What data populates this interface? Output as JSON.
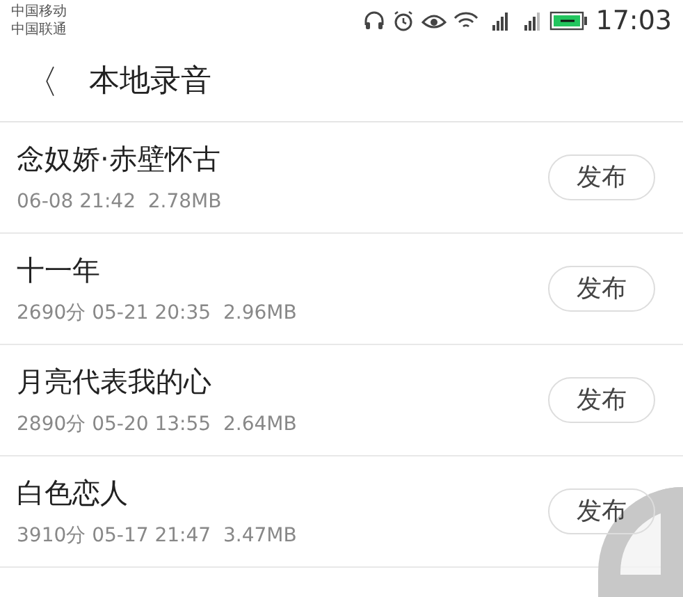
{
  "status_bar": {
    "carriers": [
      "中国移动",
      "中国联通"
    ],
    "time": "17:03"
  },
  "header": {
    "back": "〈",
    "title": "本地录音"
  },
  "recordings": [
    {
      "title": "念奴娇·赤壁怀古",
      "meta": "06-08 21:42  2.78MB",
      "button": "发布"
    },
    {
      "title": "十一年",
      "meta": "2690分 05-21 20:35  2.96MB",
      "button": "发布"
    },
    {
      "title": "月亮代表我的心",
      "meta": "2890分 05-20 13:55  2.64MB",
      "button": "发布"
    },
    {
      "title": "白色恋人",
      "meta": "3910分 05-17 21:47  3.47MB",
      "button": "发布"
    }
  ]
}
